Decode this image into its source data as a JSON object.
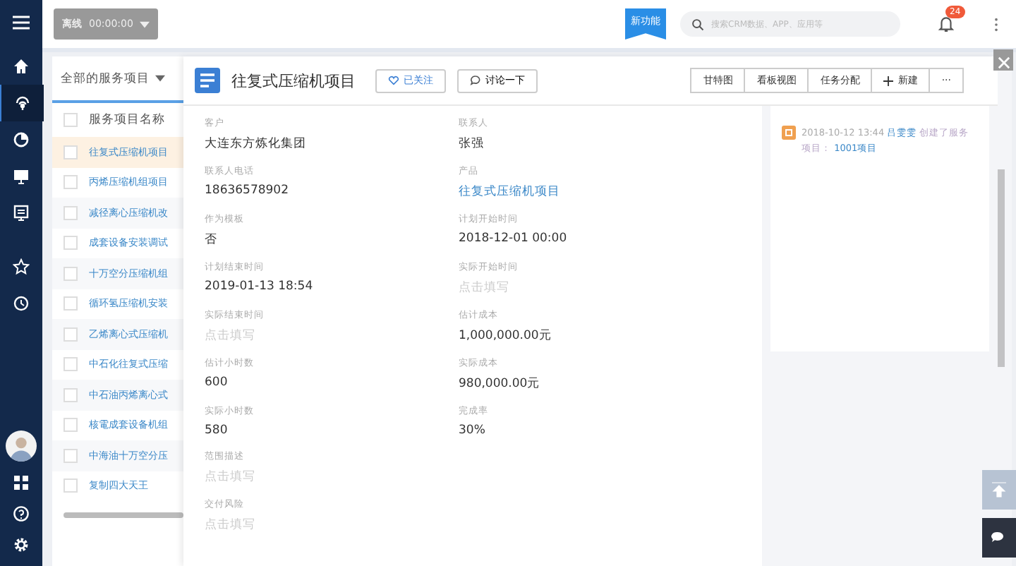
{
  "topbar": {
    "status": "离线",
    "timer": "00:00:00",
    "ribbon": "新功能",
    "search_placeholder": "搜索CRM数据、APP、应用等",
    "notifications": "24"
  },
  "sidebar": {
    "items": [
      {
        "selected": false
      },
      {
        "selected": true
      },
      {
        "selected": false
      },
      {
        "selected": false
      },
      {
        "selected": false
      },
      {
        "selected": false
      },
      {
        "selected": false
      }
    ]
  },
  "list": {
    "filter": "全部的服务项目",
    "column": "服务项目名称",
    "all_checked": false,
    "rows": [
      {
        "name": "往复式压缩机项目",
        "selected": true,
        "checked": false
      },
      {
        "name": "丙烯压缩机组项目",
        "selected": false,
        "checked": false
      },
      {
        "name": "减径离心压缩机改",
        "selected": false,
        "checked": false
      },
      {
        "name": "成套设备安装调试",
        "selected": false,
        "checked": false
      },
      {
        "name": "十万空分压缩机组",
        "selected": false,
        "checked": false
      },
      {
        "name": "循环氢压缩机安装",
        "selected": false,
        "checked": false
      },
      {
        "name": "乙烯离心式压缩机",
        "selected": false,
        "checked": false
      },
      {
        "name": "中石化往复式压缩",
        "selected": false,
        "checked": false
      },
      {
        "name": "中石油丙烯离心式",
        "selected": false,
        "checked": false
      },
      {
        "name": "核電成套设备机组",
        "selected": false,
        "checked": false
      },
      {
        "name": "中海油十万空分压",
        "selected": false,
        "checked": false
      },
      {
        "name": "复制四大天王",
        "selected": false,
        "checked": false
      }
    ]
  },
  "detail": {
    "title": "往复式压缩机项目",
    "follow": "已关注",
    "discuss": "讨论一下",
    "actions": [
      "甘特图",
      "看板视图",
      "任务分配",
      "新建",
      "···"
    ],
    "fields": [
      {
        "label": "客户",
        "value": "大连东方炼化集团",
        "kind": "text"
      },
      {
        "label": "联系人",
        "value": "张强",
        "kind": "text"
      },
      {
        "label": "联系人电话",
        "value": "18636578902",
        "kind": "text"
      },
      {
        "label": "产品",
        "value": "往复式压缩机项目",
        "kind": "link"
      },
      {
        "label": "作为模板",
        "value": "否",
        "kind": "text"
      },
      {
        "label": "计划开始时间",
        "value": "2018-12-01 00:00",
        "kind": "text"
      },
      {
        "label": "计划结束时间",
        "value": "2019-01-13 18:54",
        "kind": "text"
      },
      {
        "label": "实际开始时间",
        "placeholder": "点击填写"
      },
      {
        "label": "实际结束时间",
        "placeholder": "点击填写"
      },
      {
        "label": "估计成本",
        "value": "1,000,000.00元",
        "kind": "text"
      },
      {
        "label": "估计小时数",
        "value": "600",
        "kind": "text"
      },
      {
        "label": "实际成本",
        "value": "980,000.00元",
        "kind": "text"
      },
      {
        "label": "实际小时数",
        "value": "580",
        "kind": "text"
      },
      {
        "label": "完成率",
        "value": "30%",
        "kind": "text"
      }
    ],
    "notes": [
      {
        "label": "范围描述",
        "placeholder": "点击填写"
      },
      {
        "label": "交付风险",
        "placeholder": "点击填写"
      }
    ],
    "activity": [
      {
        "time": "2018-10-12 13:44",
        "user": "吕雯雯",
        "action": "创建了服务项目：",
        "target": "1001项目"
      }
    ]
  }
}
